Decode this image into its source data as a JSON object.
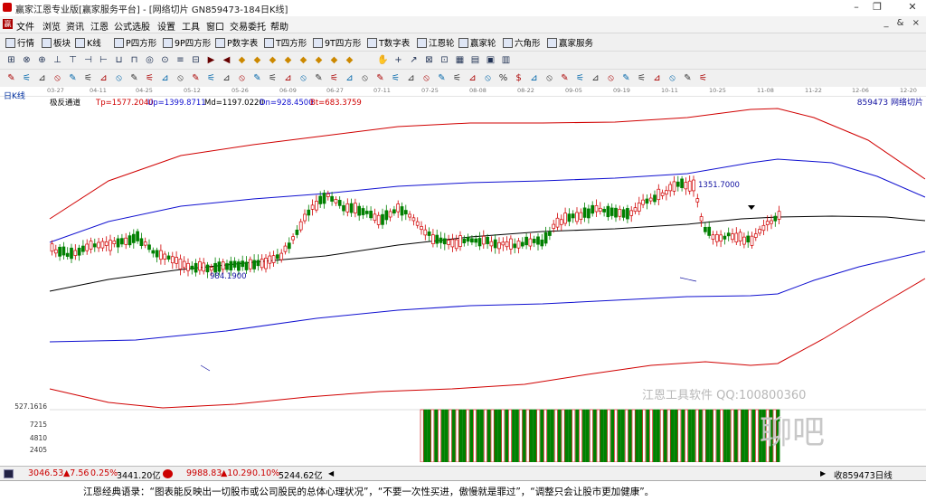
{
  "window": {
    "title": "赢家江恩专业版[赢家服务平台] - [网络切片 GN859473-184日K线]",
    "controls": [
      "–",
      "❐",
      "✕"
    ]
  },
  "menu": {
    "items": [
      "文件",
      "浏览",
      "资讯",
      "江恩",
      "公式选股",
      "设置",
      "工具",
      "窗口",
      "交易委托",
      "帮助"
    ],
    "right": "_ & ×"
  },
  "toolbar1": {
    "items": [
      {
        "label": "行情",
        "icon": "grid-icon"
      },
      {
        "label": "板块",
        "icon": "block-icon"
      },
      {
        "label": "K线",
        "icon": "kline-icon"
      },
      {
        "label": "P四方形",
        "icon": "p4-icon"
      },
      {
        "label": "9P四方形",
        "icon": "9p4-icon"
      },
      {
        "label": "P数字表",
        "icon": "pnum-icon"
      },
      {
        "label": "T四方形",
        "icon": "t4-icon"
      },
      {
        "label": "9T四方形",
        "icon": "9t4-icon"
      },
      {
        "label": "T数字表",
        "icon": "tnum-icon"
      },
      {
        "label": "江恩轮",
        "icon": "gann-wheel-icon"
      },
      {
        "label": "赢家轮",
        "icon": "winner-wheel-icon"
      },
      {
        "label": "六角形",
        "icon": "hexagon-icon"
      },
      {
        "label": "赢家服务",
        "icon": "service-icon"
      }
    ]
  },
  "chart": {
    "period_label": "日K线",
    "indicator_name": "极反通道",
    "legend": [
      {
        "text": "Tp=1577.2040",
        "color": "#d00000"
      },
      {
        "text": "Up=1399.8711",
        "color": "#1010d0"
      },
      {
        "text": "Md=1197.0220",
        "color": "#000000"
      },
      {
        "text": "Dn=928.4500",
        "color": "#1010d0"
      },
      {
        "text": "Bt=683.3759",
        "color": "#d00000"
      }
    ],
    "code_label": "859473  网络切片",
    "high_label": "1351.7000",
    "low_label": "984.1900",
    "date_ticks": [
      "03-27",
      "04-11",
      "04-25",
      "05-12",
      "05-26",
      "06-09",
      "06-27",
      "07-11",
      "07-25",
      "08-08",
      "08-22",
      "09-05",
      "09-19",
      "10-11",
      "10-25",
      "11-08",
      "11-22",
      "12-06",
      "12-20"
    ],
    "volume_axis": [
      "527.1616",
      "7215",
      "4810",
      "2405"
    ],
    "watermark": "江恩工具软件  QQ:100800360",
    "watermark2": "聊吧",
    "colors": {
      "up": "#d00000",
      "down": "#008000",
      "mid": "#000000",
      "band_outer": "#d00000",
      "band_inner": "#1010d0"
    }
  },
  "status": {
    "sh_index": "3046.53",
    "sh_change": "▲7.56",
    "sh_pct": "0.25%",
    "sh_amount": "3441.20亿",
    "sz_index": "9988.83",
    "sz_change": "▲10.29",
    "sz_pct": "0.10%",
    "sz_amount": "5244.62亿",
    "right_text": "收859473日线"
  },
  "quote_line": "江恩经典语录：“图表能反映出一切股市或公司股民的总体心理状况”，“不要一次性买进，傲慢就是罪过”，“调整只会让股市更加健康”。"
}
